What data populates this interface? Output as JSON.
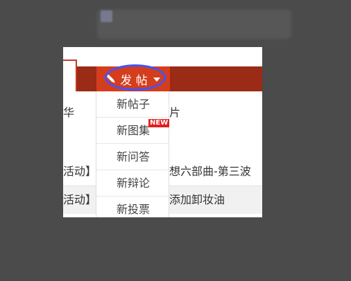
{
  "header": {
    "post_button_label": "发 帖",
    "menu": [
      {
        "label": "新帖子",
        "badge": ""
      },
      {
        "label": "新图集",
        "badge": "NEW"
      },
      {
        "label": "新问答",
        "badge": ""
      },
      {
        "label": "新辩论",
        "badge": ""
      },
      {
        "label": "新投票",
        "badge": ""
      }
    ]
  },
  "nav": {
    "left_fragment": "华",
    "right_fragment": "片"
  },
  "posts": [
    {
      "left": "活动】西",
      "right": "想六部曲-第三波"
    },
    {
      "left": "活动】知",
      "right": "添加卸妆油"
    }
  ],
  "colors": {
    "bar": "#9b2a16",
    "button": "#d43d1d",
    "highlight": "#3f55ff",
    "badge": "#e11f1f"
  },
  "icons": {
    "post": "pencil-icon",
    "dropdown": "chevron-down-icon"
  }
}
